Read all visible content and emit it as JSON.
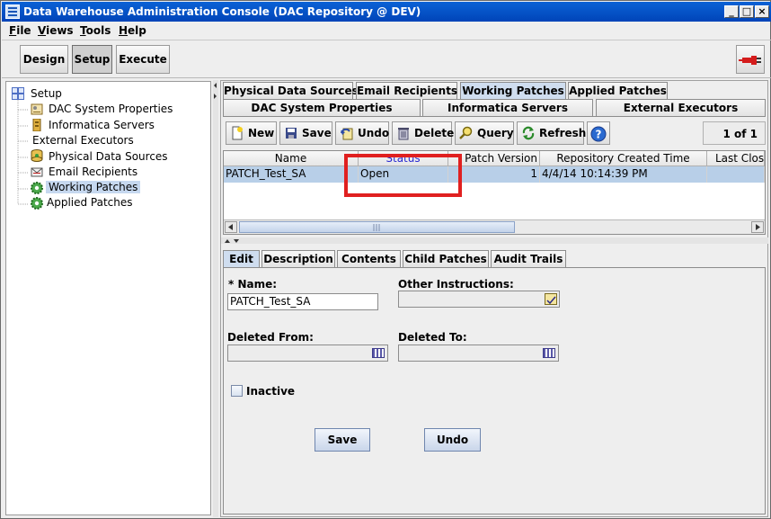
{
  "window": {
    "title": "Data Warehouse Administration Console (DAC Repository @ DEV)"
  },
  "menu": {
    "items": [
      {
        "label": "File",
        "key": "F",
        "rest": "ile"
      },
      {
        "label": "Views",
        "key": "V",
        "rest": "iews"
      },
      {
        "label": "Tools",
        "key": "T",
        "rest": "ools"
      },
      {
        "label": "Help",
        "key": "H",
        "rest": "elp"
      }
    ]
  },
  "toolbar": {
    "design": "Design",
    "setup": "Setup",
    "execute": "Execute"
  },
  "tree": {
    "root": "Setup",
    "items": [
      "DAC System Properties",
      "Informatica Servers",
      "External Executors",
      "Physical Data Sources",
      "Email Recipients",
      "Working Patches",
      "Applied Patches"
    ],
    "selected": "Working Patches"
  },
  "top_tabs": {
    "row1": [
      "Physical Data Sources",
      "Email Recipients",
      "Working Patches",
      "Applied Patches"
    ],
    "row2": [
      "DAC System Properties",
      "Informatica Servers",
      "External Executors"
    ],
    "active": "Working Patches"
  },
  "actions": {
    "new": "New",
    "save": "Save",
    "undo": "Undo",
    "delete": "Delete",
    "query": "Query",
    "refresh": "Refresh",
    "help": "?",
    "record_count": "1 of 1"
  },
  "grid": {
    "columns": [
      "Name",
      "Status",
      "Patch Version",
      "Repository Created Time",
      "Last Clos"
    ],
    "rows": [
      [
        "PATCH_Test_SA",
        "Open",
        "1",
        "4/4/14 10:14:39 PM",
        ""
      ]
    ]
  },
  "detail_tabs": {
    "items": [
      "Edit",
      "Description",
      "Contents",
      "Child Patches",
      "Audit Trails"
    ],
    "active": "Edit"
  },
  "form": {
    "name_label": "* Name:",
    "name_value": "PATCH_Test_SA",
    "other_label": "Other Instructions:",
    "deleted_from_label": "Deleted From:",
    "deleted_to_label": "Deleted To:",
    "inactive_label": "Inactive",
    "inactive_checked": false,
    "save": "Save",
    "undo": "Undo"
  },
  "colors": {
    "titlebar": "#0a5ad4",
    "selected_row": "#b8cfe8",
    "highlight_box": "#e02020",
    "status_header": "#2a2ad0"
  }
}
